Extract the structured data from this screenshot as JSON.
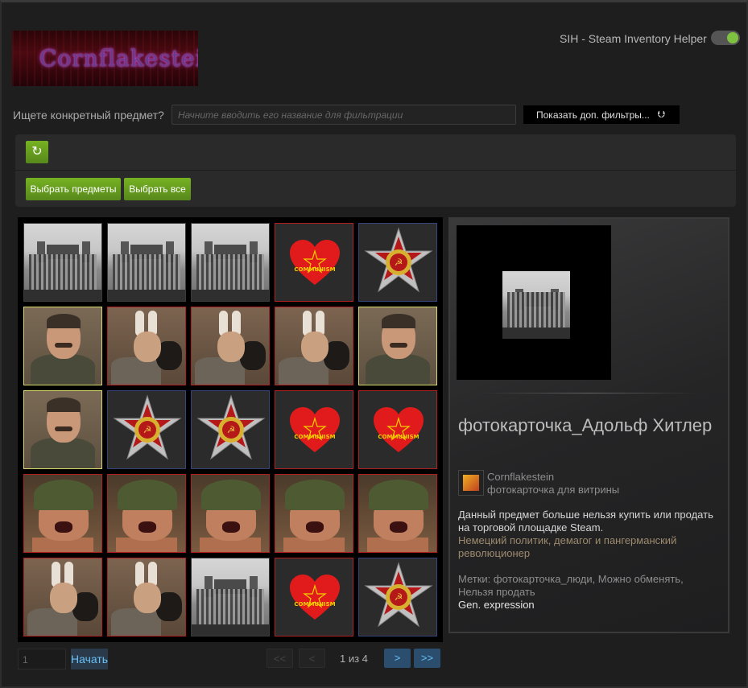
{
  "header": {
    "logo_text": "Cornflakestein",
    "sih_label": "SIH - Steam Inventory Helper"
  },
  "filter": {
    "label": "Ищете конкретный предмет?",
    "placeholder": "Начните вводить его название для фильтрации",
    "more_filters_label": "Показать доп. фильтры..."
  },
  "actions": {
    "refresh_icon": "refresh-icon",
    "select_items_label": "Выбрать предметы",
    "select_all_label": "Выбрать все"
  },
  "grid": {
    "rows": [
      [
        "reichstag",
        "reichstag",
        "reichstag",
        "communism-heart",
        "war-medal"
      ],
      [
        "stalin",
        "hitler-bunny",
        "hitler-bunny",
        "hitler-bunny",
        "stalin"
      ],
      [
        "stalin",
        "war-medal",
        "war-medal",
        "communism-heart",
        "communism-heart"
      ],
      [
        "soldier",
        "soldier",
        "soldier",
        "soldier",
        "soldier"
      ],
      [
        "hitler-bunny",
        "hitler-bunny",
        "reichstag",
        "communism-heart",
        "war-medal"
      ]
    ]
  },
  "detail": {
    "item_name": "фотокарточка_Адольф Хитлер",
    "game_name": "Cornflakestein",
    "item_type": "фотокарточка для витрины",
    "description": "Данный предмет больше нельзя купить или продать на торговой площадке Steam.",
    "flavor_text": "Немецкий политик, демагог и пангерманский революционер",
    "tags": "Метки: фотокарточка_люди, Можно обменять, Нельзя продать",
    "expression": "Gen. expression"
  },
  "pagination": {
    "page_input_value": "1",
    "go_label": "Начать",
    "first_label": "<<",
    "prev_label": "<",
    "page_text": "1 из 4",
    "next_label": ">",
    "last_label": ">>"
  },
  "colors": {
    "accent_green": "#75b022",
    "link_blue": "#66c0f4",
    "border_red": "#b01e22",
    "border_blue": "#34437a",
    "border_yellow": "#d8d86a"
  }
}
